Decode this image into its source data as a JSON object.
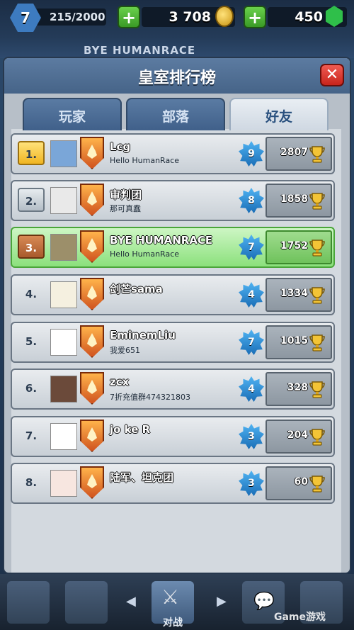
{
  "topbar": {
    "level": "7",
    "xp": "215/2000",
    "gold": "3 708",
    "gems": "450",
    "colors": {
      "plus": "#3a9a26",
      "gold": "#f0b522",
      "gem": "#2fbf4a"
    }
  },
  "behind_panel": {
    "clan_name": "BYE HUMANRACE"
  },
  "panel": {
    "title": "皇室排行榜",
    "close_icon": "close-icon",
    "tabs": [
      {
        "label": "玩家",
        "active": false
      },
      {
        "label": "部落",
        "active": false
      },
      {
        "label": "好友",
        "active": true
      }
    ]
  },
  "leaderboard": [
    {
      "rank": "1.",
      "name": "Lcg",
      "clan": "Hello HumanRace",
      "arena": "9",
      "trophies": "2807"
    },
    {
      "rank": "2.",
      "name": "审判团",
      "clan": "那可真蠢",
      "arena": "8",
      "trophies": "1858"
    },
    {
      "rank": "3.",
      "name": "BYE HUMANRACE",
      "clan": "Hello HumanRace",
      "arena": "7",
      "trophies": "1752",
      "self": true
    },
    {
      "rank": "4.",
      "name": "剑芒sama",
      "clan": "",
      "arena": "4",
      "trophies": "1334"
    },
    {
      "rank": "5.",
      "name": "EminemLiu",
      "clan": "我爱651",
      "arena": "7",
      "trophies": "1015"
    },
    {
      "rank": "6.",
      "name": "zcx",
      "clan": "7折充值群474321803",
      "arena": "4",
      "trophies": "328"
    },
    {
      "rank": "7.",
      "name": "jo ke R",
      "clan": "",
      "arena": "3",
      "trophies": "204"
    },
    {
      "rank": "8.",
      "name": "陆军、坦克团",
      "clan": "",
      "arena": "3",
      "trophies": "60"
    }
  ],
  "bottomnav": {
    "battle_label": "对战",
    "watermark": "Game游戏"
  }
}
